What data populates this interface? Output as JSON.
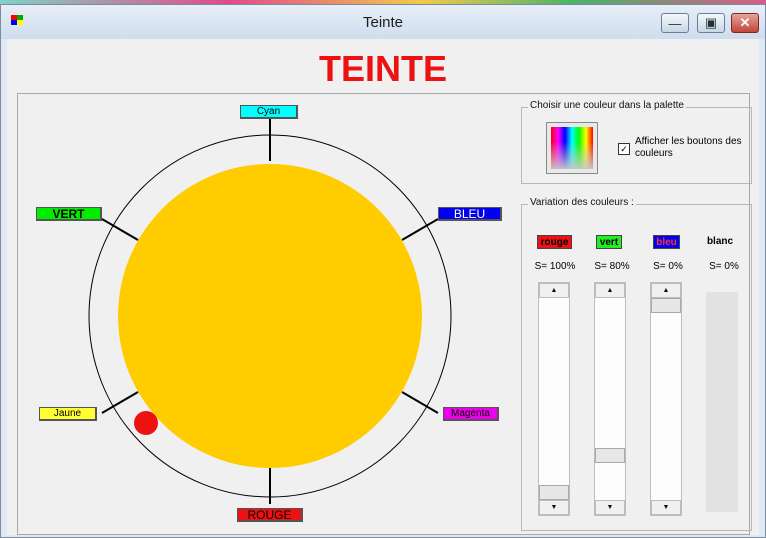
{
  "window": {
    "title": "Teinte"
  },
  "main_title": "TEINTE",
  "wheel": {
    "labels": {
      "cyan": "Cyan",
      "vert": "VERT",
      "bleu": "BLEU",
      "jaune": "Jaune",
      "magenta": "Magenta",
      "rouge": "ROUGE"
    },
    "fill_color": "#FFCC00",
    "marker_color": "#EE1111"
  },
  "palette": {
    "legend": "Choisir une couleur dans la palette",
    "checkbox_label": "Afficher les boutons des couleurs",
    "checkbox_checked": true
  },
  "variation": {
    "legend": "Variation des couleurs :",
    "channels": [
      {
        "name": "rouge",
        "value": "S= 100%",
        "level": 1.0
      },
      {
        "name": "vert",
        "value": "S= 80%",
        "level": 0.8
      },
      {
        "name": "bleu",
        "value": "S= 0%",
        "level": 0.0
      },
      {
        "name": "blanc",
        "value": "S= 0%",
        "level": 0.0
      }
    ]
  }
}
